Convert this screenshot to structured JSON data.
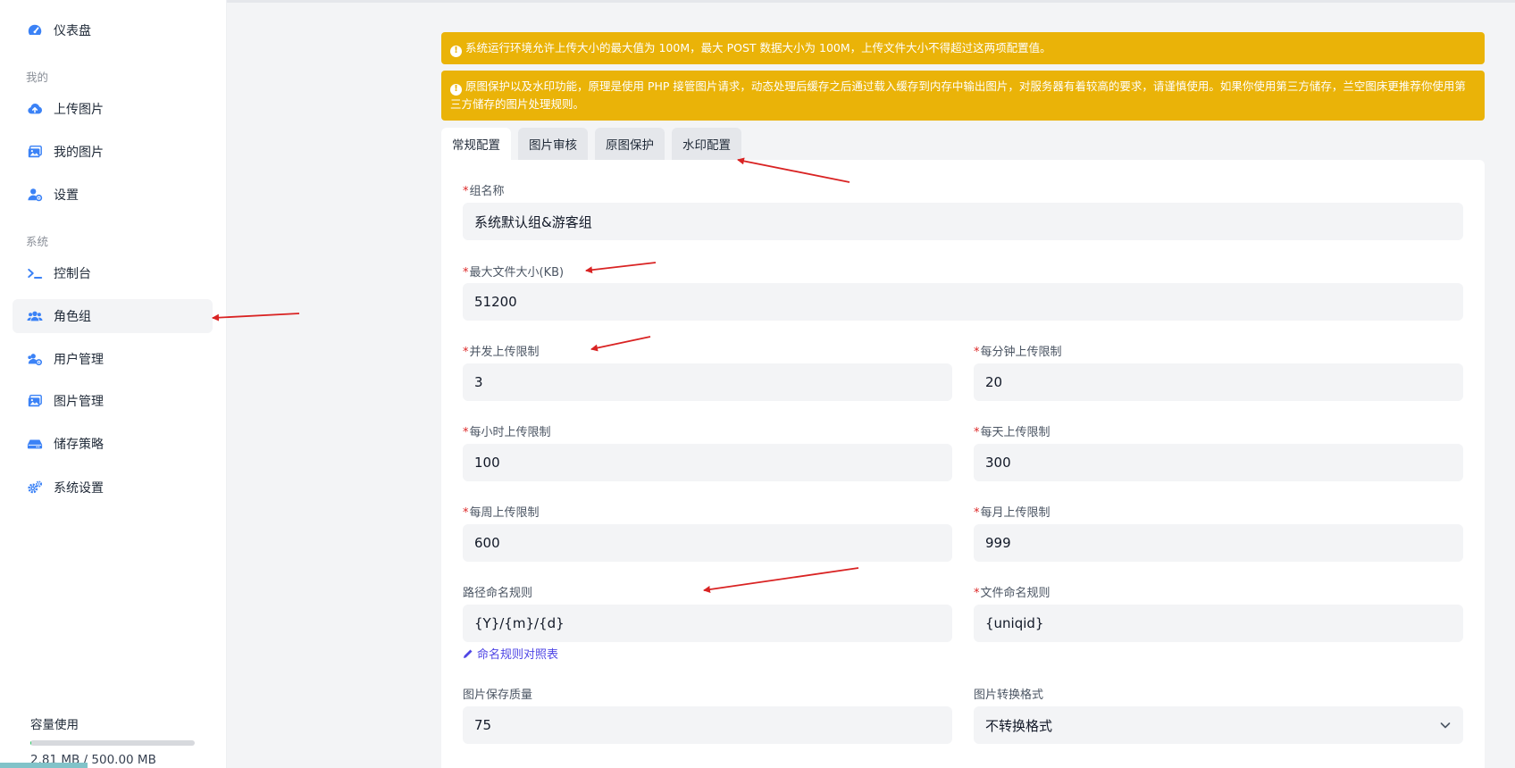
{
  "sidebar": {
    "items": [
      {
        "label": "仪表盘",
        "icon": "dashboard-icon"
      },
      {
        "label": "上传图片",
        "icon": "cloud-upload-icon"
      },
      {
        "label": "我的图片",
        "icon": "images-icon"
      },
      {
        "label": "设置",
        "icon": "user-cog-icon"
      },
      {
        "label": "控制台",
        "icon": "terminal-icon"
      },
      {
        "label": "角色组",
        "icon": "users-icon"
      },
      {
        "label": "用户管理",
        "icon": "users-cog-icon"
      },
      {
        "label": "图片管理",
        "icon": "images-icon"
      },
      {
        "label": "储存策略",
        "icon": "hard-drive-icon"
      },
      {
        "label": "系统设置",
        "icon": "cogs-icon"
      }
    ],
    "sections": {
      "mine": "我的",
      "system": "系统"
    },
    "storage": {
      "title": "容量使用",
      "text": "2.81 MB / 500.00 MB",
      "used_fraction": 0.0056
    }
  },
  "alerts": [
    "系统运行环境允许上传大小的最大值为 100M，最大 POST 数据大小为 100M，上传文件大小不得超过这两项配置值。",
    "原图保护以及水印功能，原理是使用 PHP 接管图片请求，动态处理后缓存之后通过载入缓存到内存中输出图片，对服务器有着较高的要求，请谨慎使用。如果你使用第三方储存，兰空图床更推荐你使用第三方储存的图片处理规则。"
  ],
  "tabs": [
    "常规配置",
    "图片审核",
    "原图保护",
    "水印配置"
  ],
  "form": {
    "group_name": {
      "label": "组名称",
      "value": "系统默认组&游客组"
    },
    "max_file_size": {
      "label": "最大文件大小(KB)",
      "value": "51200"
    },
    "concurrent_limit": {
      "label": "并发上传限制",
      "value": "3"
    },
    "per_minute_limit": {
      "label": "每分钟上传限制",
      "value": "20"
    },
    "per_hour_limit": {
      "label": "每小时上传限制",
      "value": "100"
    },
    "per_day_limit": {
      "label": "每天上传限制",
      "value": "300"
    },
    "per_week_limit": {
      "label": "每周上传限制",
      "value": "600"
    },
    "per_month_limit": {
      "label": "每月上传限制",
      "value": "999"
    },
    "path_rule": {
      "label": "路径命名规则",
      "value": "{Y}/{m}/{d}"
    },
    "file_rule": {
      "label": "文件命名规则",
      "value": "{uniqid}"
    },
    "naming_table_link": "命名规则对照表",
    "quality": {
      "label": "图片保存质量",
      "value": "75"
    },
    "convert_format": {
      "label": "图片转换格式",
      "value": "不转换格式"
    }
  },
  "colors": {
    "alert": "#eab308",
    "accent": "#3b82f6",
    "link": "#4f46e5",
    "required": "#dc2626",
    "annotation_arrow": "#d92323"
  }
}
